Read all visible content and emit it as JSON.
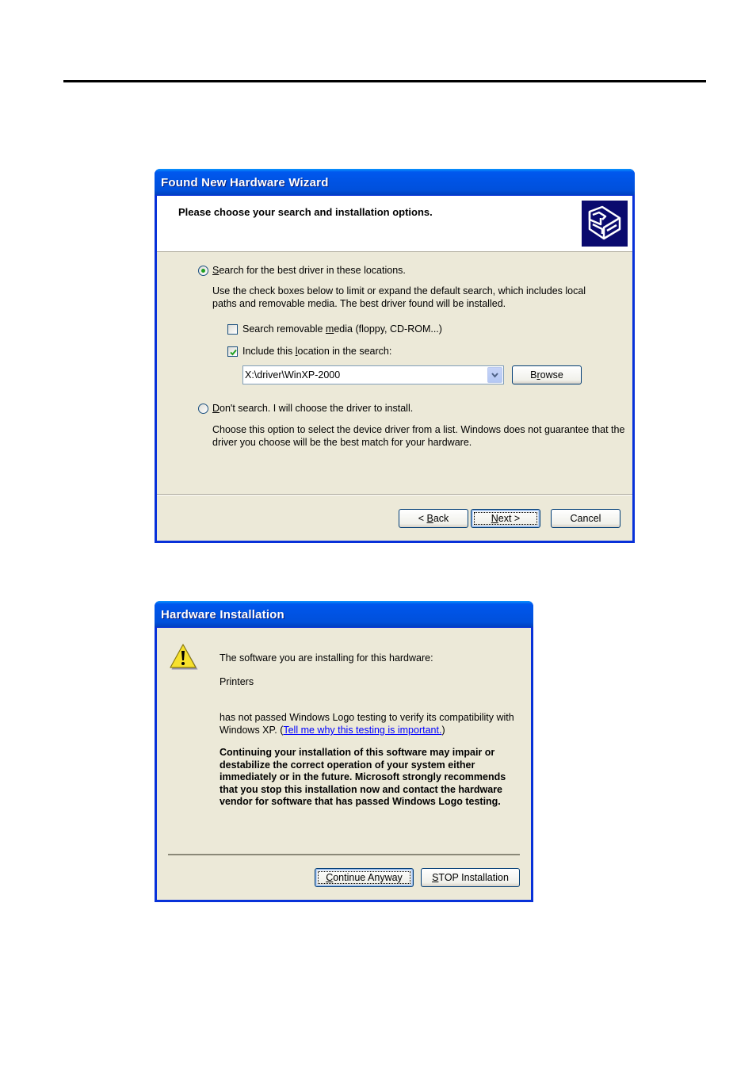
{
  "wizard": {
    "title": "Found New Hardware Wizard",
    "header_title": "Please choose your search and installation options.",
    "header_icon": "hardware-install-icon",
    "option_search": {
      "label_underline": "S",
      "label_rest": "earch for the best driver in these locations.",
      "selected": true,
      "description": "Use the check boxes below to limit or expand the default search, which includes local paths and removable media. The best driver found will be installed."
    },
    "check_removable": {
      "label_pre": "Search removable ",
      "label_underline": "m",
      "label_post": "edia (floppy, CD-ROM...)",
      "checked": false
    },
    "check_location": {
      "label_pre": "Include this ",
      "label_underline": "l",
      "label_post": "ocation in the search:",
      "checked": true
    },
    "location_value": "X:\\driver\\WinXP-2000",
    "browse": {
      "pre": "B",
      "underline": "r",
      "post": "owse"
    },
    "option_dont_search": {
      "label_underline": "D",
      "label_rest": "on't search. I will choose the driver to install.",
      "selected": false,
      "description": "Choose this option to select the device driver from a list.  Windows does not guarantee that the driver you choose will be the best match for your hardware."
    },
    "buttons": {
      "back": {
        "pre": "< ",
        "underline": "B",
        "post": "ack"
      },
      "next": {
        "pre": "",
        "underline": "N",
        "post": "ext >"
      },
      "cancel": "Cancel"
    }
  },
  "hardware_installation": {
    "title": "Hardware Installation",
    "icon": "warning-icon",
    "intro": "The software you are installing for this hardware:",
    "device": "Printers",
    "notice_pre": "has not passed Windows Logo testing to verify its compatibility with Windows XP. (",
    "notice_link": "Tell me why this testing is important.",
    "notice_post": ")",
    "warning": "Continuing your installation of this software may impair or destabilize the correct operation of your system either immediately or in the future. Microsoft strongly recommends that you stop this installation now and contact the hardware vendor for software that has passed Windows Logo testing.",
    "buttons": {
      "continue": {
        "underline": "C",
        "post": "ontinue Anyway"
      },
      "stop": {
        "underline": "S",
        "post": "TOP Installation"
      }
    }
  }
}
